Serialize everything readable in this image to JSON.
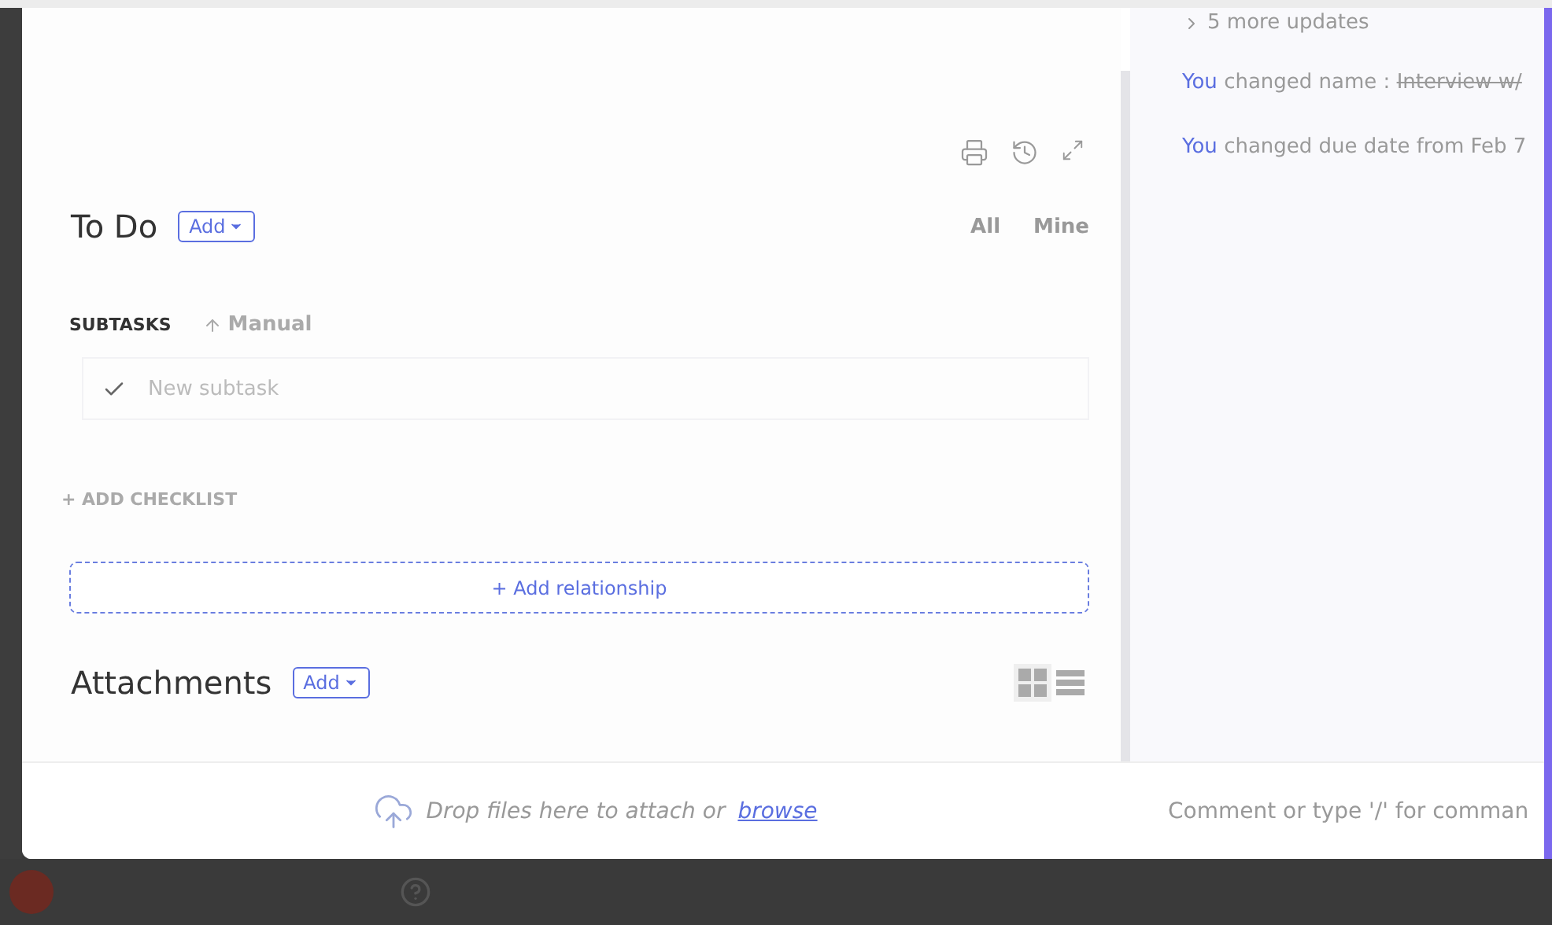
{
  "task_panel": {
    "status": {
      "label": "To Do",
      "add_button": "Add"
    },
    "filters": [
      {
        "label": "All",
        "selected": false
      },
      {
        "label": "Mine",
        "selected": false
      }
    ],
    "subtasks": {
      "heading": "SUBTASKS",
      "sort": "Manual",
      "new_placeholder": "New subtask"
    },
    "add_checklist": "+ ADD CHECKLIST",
    "add_relationship": "+ Add relationship",
    "attachments": {
      "title": "Attachments",
      "add_button": "Add",
      "views": [
        {
          "kind": "grid",
          "selected": true
        },
        {
          "kind": "list",
          "selected": false
        }
      ]
    },
    "drop_zone": {
      "text": "Drop files here to attach or",
      "link": "browse"
    }
  },
  "activity": {
    "more_updates": "5 more updates",
    "entries": [
      {
        "actor": "You",
        "text": "changed name :",
        "old_value": "Interview w/"
      },
      {
        "actor": "You",
        "text": "changed due date from Feb 7"
      }
    ],
    "comment": {
      "placeholder": "Comment or type '/' for comman"
    }
  }
}
